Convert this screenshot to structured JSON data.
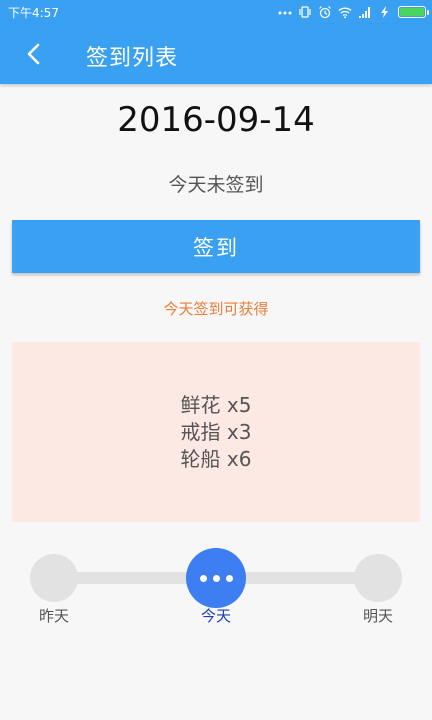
{
  "statusbar": {
    "time": "下午4:57"
  },
  "appbar": {
    "title": "签到列表"
  },
  "main": {
    "date": "2016-09-14",
    "status": "今天未签到",
    "checkin_label": "签到",
    "reward_note": "今天签到可获得",
    "rewards": [
      "鲜花 x5",
      "戒指 x3",
      "轮船 x6"
    ]
  },
  "timeline": {
    "yesterday": "昨天",
    "today": "今天",
    "tomorrow": "明天"
  },
  "colors": {
    "primary": "#3aa0f2",
    "accent_orange": "#e87e39",
    "reward_bg": "#fde9e3",
    "today_node": "#3d7ef3"
  }
}
